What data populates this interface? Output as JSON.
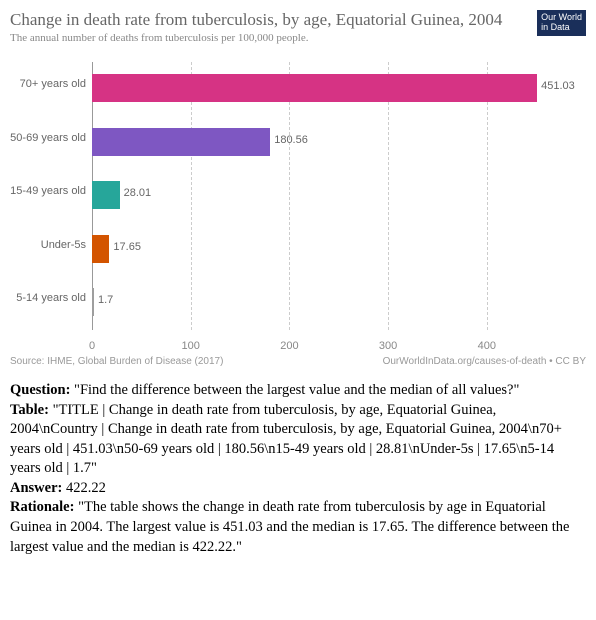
{
  "chart_data": {
    "type": "bar",
    "orientation": "horizontal",
    "title": "Change in death rate from tuberculosis, by age, Equatorial Guinea, 2004",
    "subtitle": "The annual number of deaths from tuberculosis per 100,000 people.",
    "categories": [
      "70+ years old",
      "50-69 years old",
      "15-49 years old",
      "Under-5s",
      "5-14 years old"
    ],
    "values": [
      451.03,
      180.56,
      28.01,
      17.65,
      1.7
    ],
    "value_labels": [
      "451.03",
      "180.56",
      "28.01",
      "17.65",
      "1.7"
    ],
    "colors": [
      "#d63384",
      "#7e57c2",
      "#26a69a",
      "#d35400",
      "#9e9e9e"
    ],
    "xlim": [
      0,
      460
    ],
    "xticks": [
      0,
      100,
      200,
      300,
      400
    ],
    "source_left": "Source: IHME, Global Burden of Disease (2017)",
    "source_right": "OurWorldInData.org/causes-of-death • CC BY",
    "badge": "Our World in Data"
  },
  "qa": {
    "question_label": "Question:",
    "question": "\"Find the difference between the largest value and the median of all values?\"",
    "table_label": "Table:",
    "table": "\"TITLE | Change in death rate from tuberculosis, by age, Equatorial Guinea, 2004\\nCountry | Change in death rate from tuberculosis, by age, Equatorial Guinea, 2004\\n70+ years old | 451.03\\n50-69 years old | 180.56\\n15-49 years old | 28.81\\nUnder-5s | 17.65\\n5-14 years old | 1.7\"",
    "answer_label": "Answer:",
    "answer": "422.22",
    "rationale_label": "Rationale:",
    "rationale": "\"The table shows the change in death rate from tuberculosis by age in Equatorial Guinea in 2004. The largest value is 451.03 and the median is 17.65. The difference between the largest value and the median is 422.22.\""
  }
}
